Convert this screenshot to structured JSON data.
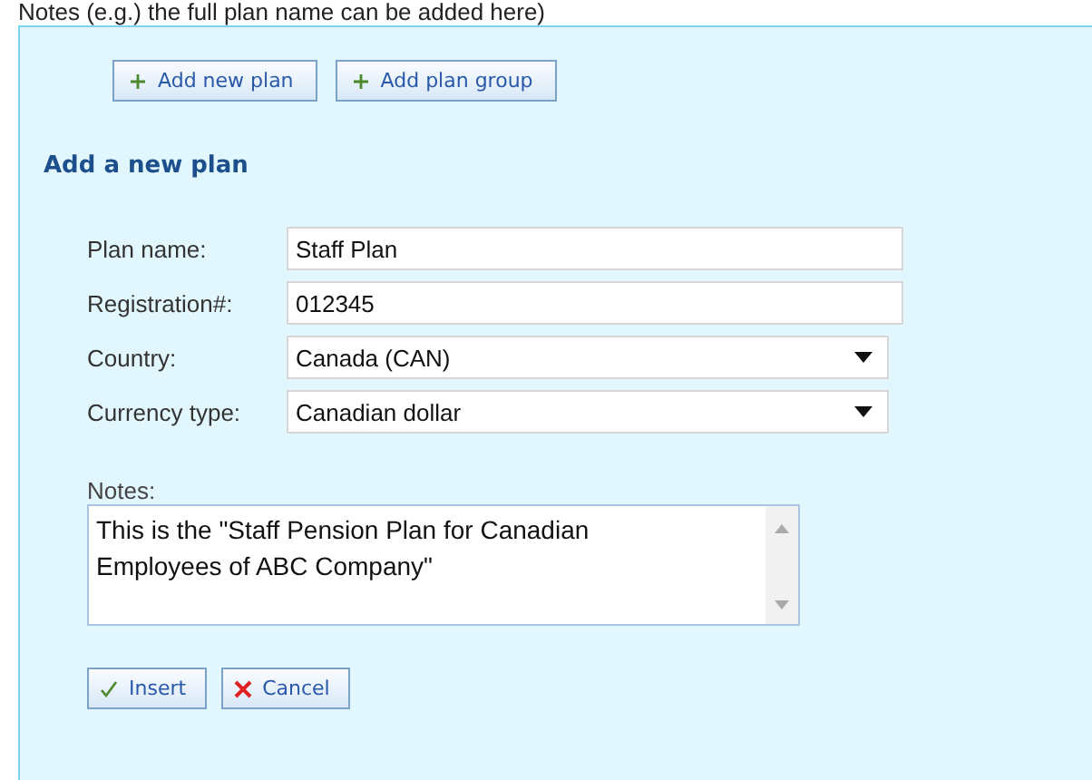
{
  "caption": "Notes (e.g.) the full plan name can be added here)",
  "toolbar": [
    {
      "label": "Add new plan"
    },
    {
      "label": "Add plan group"
    }
  ],
  "form": {
    "title": "Add a new plan",
    "fields": [
      {
        "label": "Plan name:",
        "kind": "text",
        "value": "Staff Plan"
      },
      {
        "label": "Registration#:",
        "kind": "text",
        "value": "012345"
      },
      {
        "label": "Country:",
        "kind": "select",
        "value": "Canada (CAN)"
      },
      {
        "label": "Currency type:",
        "kind": "select",
        "value": "Canadian dollar"
      }
    ],
    "notes": {
      "label": "Notes:",
      "value": "This is the \"Staff Pension Plan for Canadian Employees of ABC Company\""
    },
    "actions": [
      {
        "label": "Insert",
        "kind": "confirm"
      },
      {
        "label": "Cancel",
        "kind": "cancel"
      }
    ]
  }
}
